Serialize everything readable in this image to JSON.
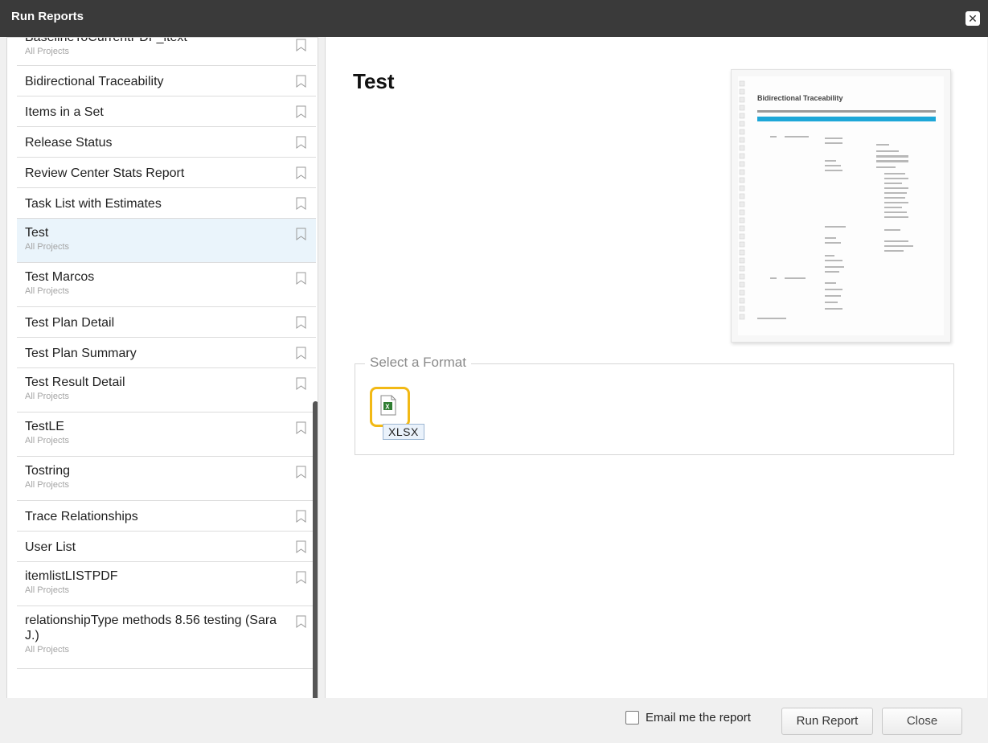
{
  "window": {
    "title": "Run Reports"
  },
  "reports": [
    {
      "name": "BaselineToCurrentPDF_itext",
      "sub": "All Projects"
    },
    {
      "name": "Bidirectional Traceability",
      "sub": ""
    },
    {
      "name": "Items in a Set",
      "sub": ""
    },
    {
      "name": "Release Status",
      "sub": ""
    },
    {
      "name": "Review Center Stats Report",
      "sub": ""
    },
    {
      "name": "Task List with Estimates",
      "sub": ""
    },
    {
      "name": "Test",
      "sub": "All Projects",
      "selected": true
    },
    {
      "name": "Test Marcos",
      "sub": "All Projects"
    },
    {
      "name": "Test Plan Detail",
      "sub": ""
    },
    {
      "name": "Test Plan Summary",
      "sub": ""
    },
    {
      "name": "Test Result Detail",
      "sub": "All Projects"
    },
    {
      "name": "TestLE",
      "sub": "All Projects"
    },
    {
      "name": "Tostring",
      "sub": "All Projects"
    },
    {
      "name": "Trace Relationships",
      "sub": ""
    },
    {
      "name": "User List",
      "sub": ""
    },
    {
      "name": "itemlistLISTPDF",
      "sub": "All Projects"
    },
    {
      "name": "relationshipType methods 8.56 testing (Sara J.)",
      "sub": "All Projects"
    }
  ],
  "detail": {
    "title": "Test",
    "preview_heading": "Bidirectional Traceability",
    "format_legend": "Select a Format",
    "formats": [
      {
        "label": "XLSX",
        "icon": "excel-file-icon",
        "selected": true
      }
    ]
  },
  "footer": {
    "email_label": "Email me the report",
    "email_checked": false,
    "run_label": "Run Report",
    "close_label": "Close"
  },
  "colors": {
    "titlebar": "#3a3a3a",
    "selection": "#eaf4fb",
    "format_highlight": "#f2b915",
    "preview_bar": "#1ea7d8"
  }
}
